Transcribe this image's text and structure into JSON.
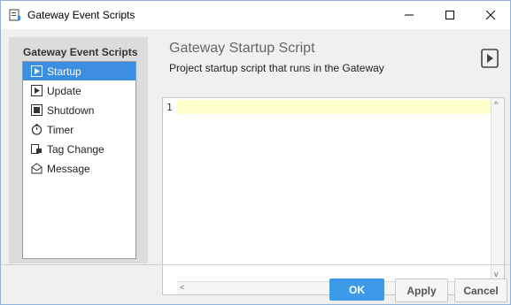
{
  "window": {
    "title": "Gateway Event Scripts"
  },
  "sidebar": {
    "header": "Gateway Event Scripts",
    "items": [
      {
        "label": "Startup",
        "icon": "script-icon",
        "selected": true
      },
      {
        "label": "Update",
        "icon": "script-icon",
        "selected": false
      },
      {
        "label": "Shutdown",
        "icon": "script-icon",
        "selected": false
      },
      {
        "label": "Timer",
        "icon": "timer-icon",
        "selected": false
      },
      {
        "label": "Tag Change",
        "icon": "tag-change-icon",
        "selected": false
      },
      {
        "label": "Message",
        "icon": "message-icon",
        "selected": false
      }
    ]
  },
  "main": {
    "title": "Gateway Startup Script",
    "subtitle": "Project startup script that runs in the Gateway",
    "editor": {
      "line_numbers": [
        "1"
      ],
      "content": ""
    }
  },
  "footer": {
    "ok_label": "OK",
    "apply_label": "Apply",
    "cancel_label": "Cancel"
  },
  "colors": {
    "accent": "#3c8ee0",
    "ok_button": "#3c9ae8",
    "current_line": "#ffffcc"
  }
}
